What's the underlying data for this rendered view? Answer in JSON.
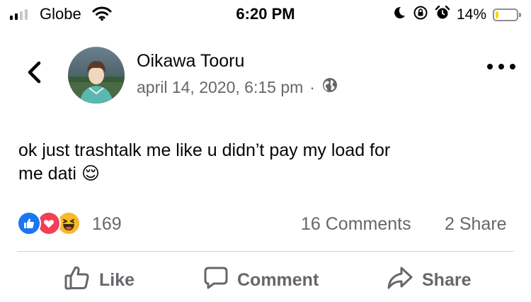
{
  "status_bar": {
    "carrier": "Globe",
    "time": "6:20 PM",
    "battery_percent_label": "14%",
    "battery_level": 0.14,
    "battery_color": "#f5d90a",
    "icons": [
      "signal-icon",
      "wifi-icon",
      "moon-icon",
      "orientation-lock-icon",
      "alarm-icon",
      "battery-icon"
    ]
  },
  "post": {
    "author": "Oikawa Tooru",
    "timestamp": "april 14, 2020, 6:15 pm",
    "separator": "·",
    "audience_icon": "globe-icon",
    "text_line1": "ok just trashtalk me like u didn’t pay my load for",
    "text_line2": "me dati",
    "emoji": "😌"
  },
  "engagement": {
    "reaction_icons": [
      "like-reaction-icon",
      "love-reaction-icon",
      "haha-reaction-icon"
    ],
    "reaction_count": "169",
    "comments": "16 Comments",
    "shares": "2 Share"
  },
  "actions": {
    "like": "Like",
    "comment": "Comment",
    "share": "Share"
  },
  "colors": {
    "like_blue": "#1877f2",
    "love_red": "#f33e58",
    "haha_yellow": "#f7b928",
    "secondary_text": "#65676b"
  }
}
